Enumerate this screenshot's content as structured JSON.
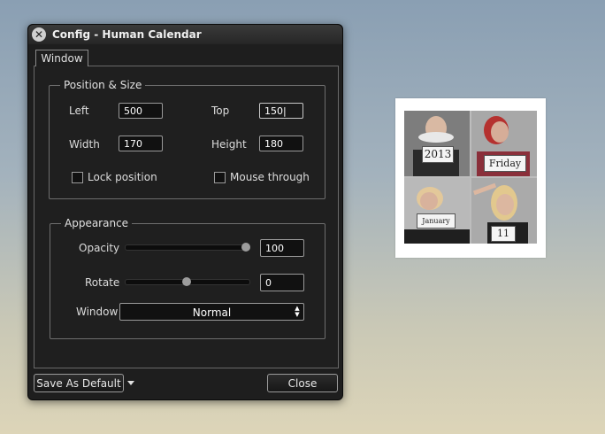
{
  "window": {
    "title": "Config - Human Calendar",
    "close_icon": "close-icon",
    "tab_label": "Window"
  },
  "position_size": {
    "legend": "Position & Size",
    "left_label": "Left",
    "left_value": "500",
    "top_label": "Top",
    "top_value": "150|",
    "width_label": "Width",
    "width_value": "170",
    "height_label": "Height",
    "height_value": "180",
    "lock_label": "Lock position",
    "lock_checked": false,
    "mouse_label": "Mouse through",
    "mouse_checked": false
  },
  "appearance": {
    "legend": "Appearance",
    "opacity_label": "Opacity",
    "opacity_value": "100",
    "opacity_level": 1.0,
    "rotate_label": "Rotate",
    "rotate_value": "0",
    "rotate_level": 0.5,
    "window_label": "Window",
    "window_select": "Normal"
  },
  "buttons": {
    "save_default": "Save As Default",
    "close": "Close"
  },
  "widget": {
    "photos": [
      {
        "card_text": "2013"
      },
      {
        "card_text": "Friday"
      },
      {
        "card_text": "January"
      },
      {
        "card_text": "11"
      }
    ]
  }
}
